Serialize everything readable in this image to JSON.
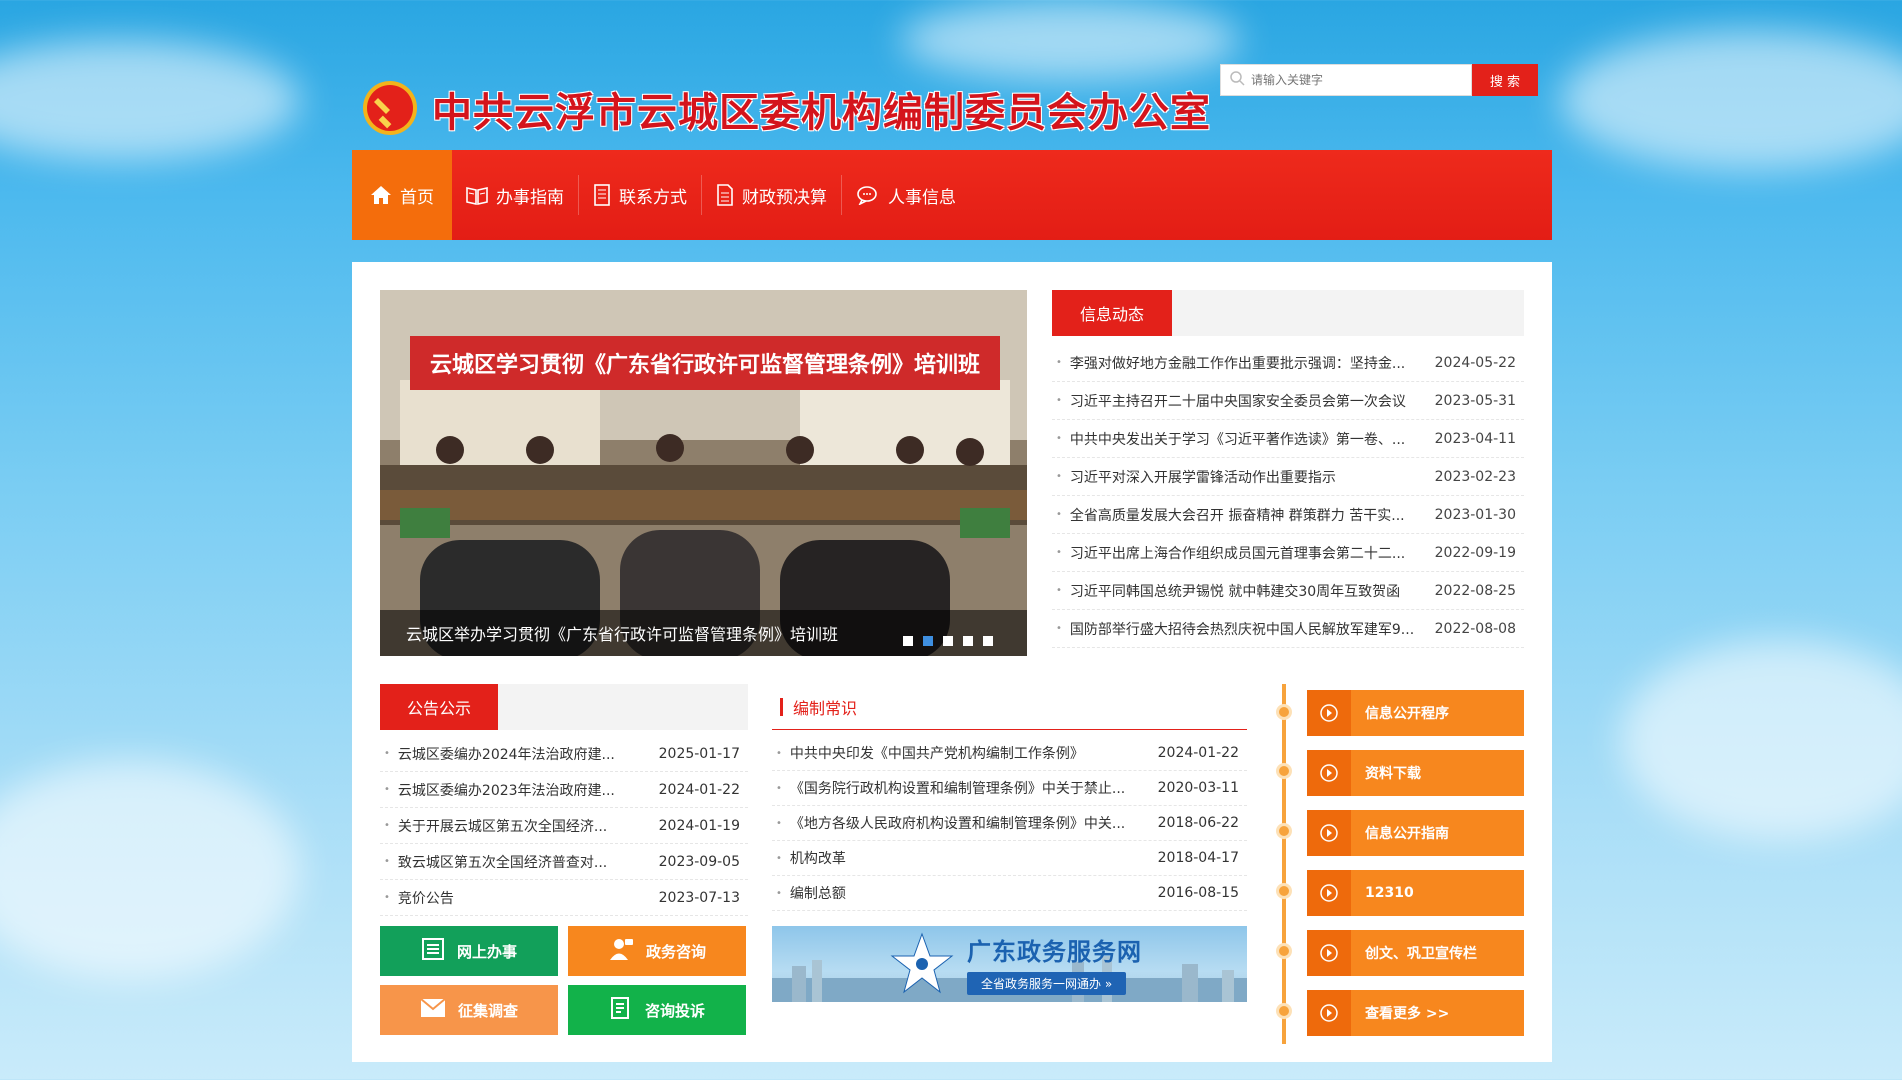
{
  "header": {
    "title": "中共云浮市云城区委机构编制委员会办公室",
    "search_placeholder": "请输入关键字",
    "search_button": "搜 索"
  },
  "nav": {
    "items": [
      {
        "label": "首页",
        "icon": "home-icon"
      },
      {
        "label": "办事指南",
        "icon": "book-icon"
      },
      {
        "label": "联系方式",
        "icon": "document-icon"
      },
      {
        "label": "财政预决算",
        "icon": "ledger-icon"
      },
      {
        "label": "人事信息",
        "icon": "chat-icon"
      }
    ]
  },
  "slide": {
    "banner_text": "云城区学习贯彻《广东省行政许可监督管理条例》培训班",
    "caption": "云城区举办学习贯彻《广东省行政许可监督管理条例》培训班",
    "dots": 5,
    "active_dot": 2
  },
  "news": {
    "tab": "信息动态",
    "items": [
      {
        "title": "李强对做好地方金融工作作出重要批示强调：坚持金...",
        "date": "2024-05-22"
      },
      {
        "title": "习近平主持召开二十届中央国家安全委员会第一次会议",
        "date": "2023-05-31"
      },
      {
        "title": "中共中央发出关于学习《习近平著作选读》第一卷、...",
        "date": "2023-04-11"
      },
      {
        "title": "习近平对深入开展学雷锋活动作出重要指示",
        "date": "2023-02-23"
      },
      {
        "title": "全省高质量发展大会召开 振奋精神 群策群力 苦干实...",
        "date": "2023-01-30"
      },
      {
        "title": "习近平出席上海合作组织成员国元首理事会第二十二...",
        "date": "2022-09-19"
      },
      {
        "title": "习近平同韩国总统尹锡悦 就中韩建交30周年互致贺函",
        "date": "2022-08-25"
      },
      {
        "title": "国防部举行盛大招待会热烈庆祝中国人民解放军建军9...",
        "date": "2022-08-08"
      }
    ]
  },
  "notice": {
    "tab": "公告公示",
    "items": [
      {
        "title": "云城区委编办2024年法治政府建...",
        "date": "2025-01-17"
      },
      {
        "title": "云城区委编办2023年法治政府建...",
        "date": "2024-01-22"
      },
      {
        "title": "关于开展云城区第五次全国经济...",
        "date": "2024-01-19"
      },
      {
        "title": "致云城区第五次全国经济普查对...",
        "date": "2023-09-05"
      },
      {
        "title": "竞价公告",
        "date": "2023-07-13"
      }
    ]
  },
  "knowledge": {
    "tab": "编制常识",
    "items": [
      {
        "title": "中共中央印发《中国共产党机构编制工作条例》",
        "date": "2024-01-22"
      },
      {
        "title": "《国务院行政机构设置和编制管理条例》中关于禁止...",
        "date": "2020-03-11"
      },
      {
        "title": "《地方各级人民政府机构设置和编制管理条例》中关...",
        "date": "2018-06-22"
      },
      {
        "title": "机构改革",
        "date": "2018-04-17"
      },
      {
        "title": "编制总额",
        "date": "2016-08-15"
      }
    ]
  },
  "services": {
    "online": "网上办事",
    "consult": "政务咨询",
    "survey": "征集调查",
    "complaint": "咨询投诉"
  },
  "gd_banner": {
    "title": "广东政务服务网",
    "subtitle": "全省政务服务一网通办 »"
  },
  "side_links": [
    {
      "label": "信息公开程序"
    },
    {
      "label": "资料下载"
    },
    {
      "label": "信息公开指南"
    },
    {
      "label": "12310"
    },
    {
      "label": "创文、巩卫宣传栏"
    },
    {
      "label": "查看更多 >>"
    }
  ],
  "colors": {
    "brand_red": "#e3211a",
    "nav_active": "#f46d0c",
    "side_orange": "#f7871e"
  }
}
